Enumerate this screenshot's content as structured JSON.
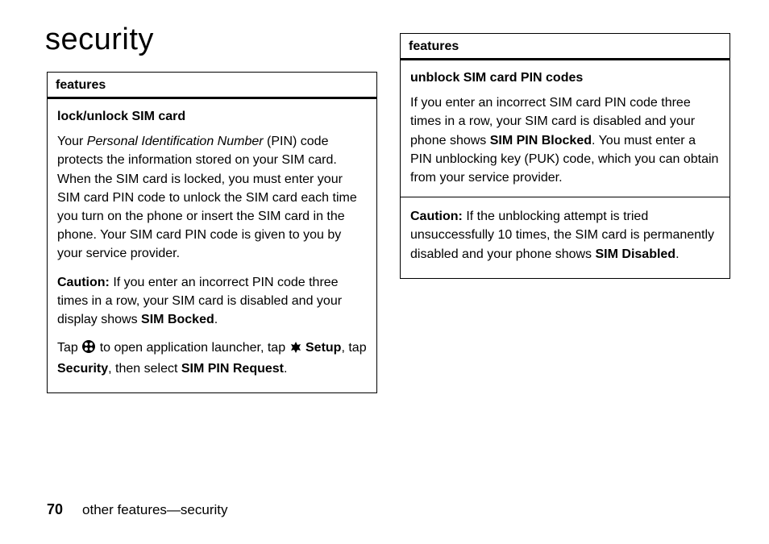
{
  "title": "security",
  "leftBox": {
    "header": "features",
    "subheading": "lock/unlock SIM card",
    "p1_pre": "Your ",
    "p1_italic": "Personal Identification Number",
    "p1_post": " (PIN) code protects the information stored on your SIM card. When the SIM card is locked, you must enter your SIM card PIN code to unlock the SIM card each time you turn on the phone or insert the SIM card in the phone. Your SIM card PIN code is given to you by your service provider.",
    "p2_cautionLabel": "Caution:",
    "p2_text": " If you enter an incorrect PIN code three times in a row, your SIM card is disabled and your display shows ",
    "p2_cond": "SIM Bocked",
    "p2_end": ".",
    "p3_a": "Tap ",
    "p3_b": " to open application launcher, tap ",
    "p3_setup": "Setup",
    "p3_c": ", tap ",
    "p3_security": "Security",
    "p3_d": ", then select ",
    "p3_simpin": "SIM PIN Request",
    "p3_e": "."
  },
  "rightBox": {
    "header": "features",
    "subheading": "unblock SIM card PIN codes",
    "p1_a": "If you enter an incorrect SIM card PIN code three times in a row, your SIM card is disabled and your phone shows ",
    "p1_cond": "SIM PIN Blocked",
    "p1_b": ". You must enter a PIN unblocking key (PUK) code, which you can obtain from your service provider.",
    "p2_cautionLabel": "Caution:",
    "p2_text": " If the unblocking attempt is tried unsuccessfully 10 times, the SIM card is permanently disabled and your phone shows ",
    "p2_cond": "SIM Disabled",
    "p2_end": "."
  },
  "footer": {
    "pageNum": "70",
    "sectionPath": "other features—security"
  }
}
